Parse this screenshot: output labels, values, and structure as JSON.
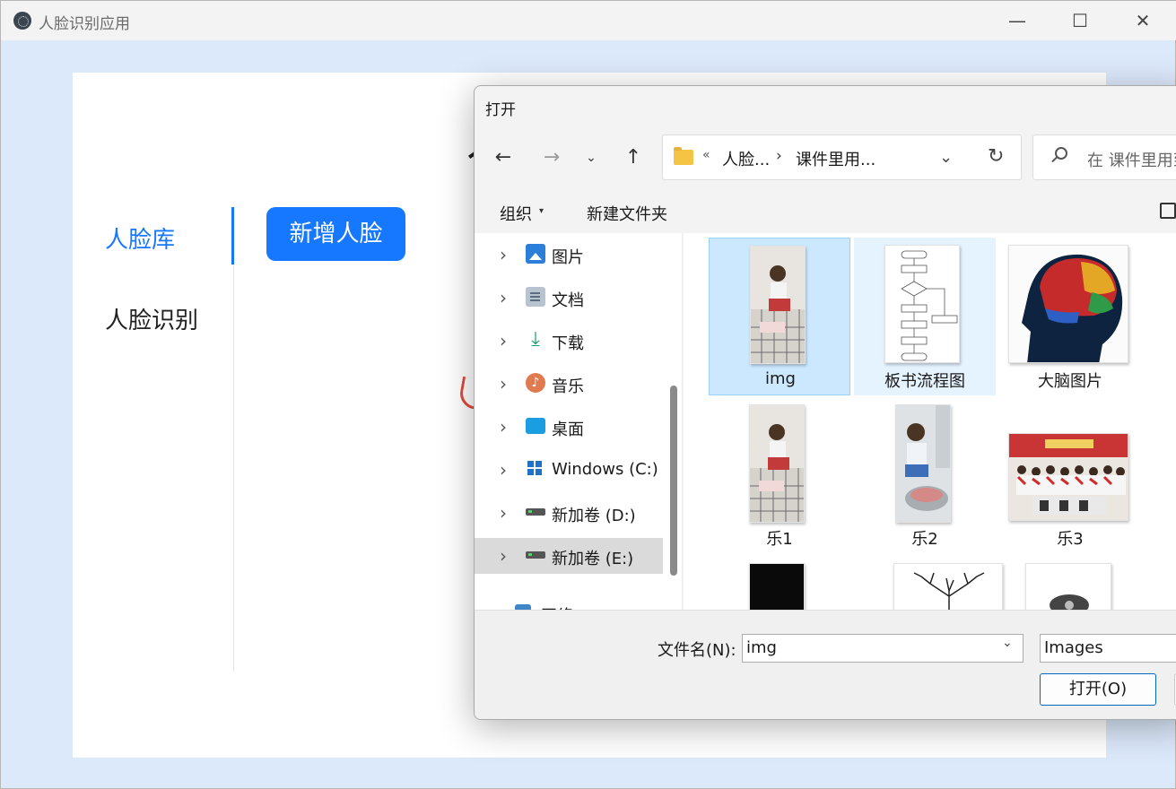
{
  "app": {
    "title": "人脸识别应用",
    "window_controls": {
      "minimize": "—",
      "maximize": "☐",
      "close": "✕"
    },
    "nav": [
      {
        "label": "人脸库",
        "active": true
      },
      {
        "label": "人脸识别",
        "active": false
      }
    ],
    "add_face_button": "新增人脸",
    "accent_color": "#1677ff"
  },
  "dialog": {
    "title": "打开",
    "nav_buttons": {
      "back": "←",
      "forward": "→",
      "recent": "⌄",
      "up": "↑"
    },
    "address": {
      "chevron": "«",
      "segments": [
        "人脸...",
        "课件里用..."
      ],
      "separator": "›",
      "dropdown": "⌄",
      "refresh": "↻"
    },
    "search_placeholder": "在 课件里用到",
    "toolbar": {
      "organize": "组织",
      "organize_caret": "▾",
      "new_folder": "新建文件夹"
    },
    "tree": [
      {
        "label": "图片",
        "icon": "pictures-icon",
        "chevron": "›"
      },
      {
        "label": "文档",
        "icon": "documents-icon",
        "chevron": "›"
      },
      {
        "label": "下载",
        "icon": "download-icon",
        "chevron": "›",
        "glyph": "⤓"
      },
      {
        "label": "音乐",
        "icon": "music-icon",
        "chevron": "›",
        "glyph": "♪"
      },
      {
        "label": "桌面",
        "icon": "desktop-icon",
        "chevron": "›"
      },
      {
        "label": "Windows (C:)",
        "icon": "windows-drive-icon",
        "chevron": "›"
      },
      {
        "label": "新加卷 (D:)",
        "icon": "drive-icon",
        "chevron": "›"
      },
      {
        "label": "新加卷 (E:)",
        "icon": "drive-icon",
        "chevron": "›",
        "selected": true
      },
      {
        "label": "网络",
        "icon": "network-icon",
        "chevron": "›"
      }
    ],
    "files": [
      {
        "name": "img",
        "selected": true
      },
      {
        "name": "板书流程图",
        "hover": true
      },
      {
        "name": "大脑图片"
      },
      {
        "name": "乐1"
      },
      {
        "name": "乐2"
      },
      {
        "name": "乐3"
      }
    ],
    "file_name_label": "文件名(N):",
    "file_name_value": "img",
    "file_name_dropdown": "⌄",
    "file_type": "Images",
    "open_button": "打开(O)"
  }
}
